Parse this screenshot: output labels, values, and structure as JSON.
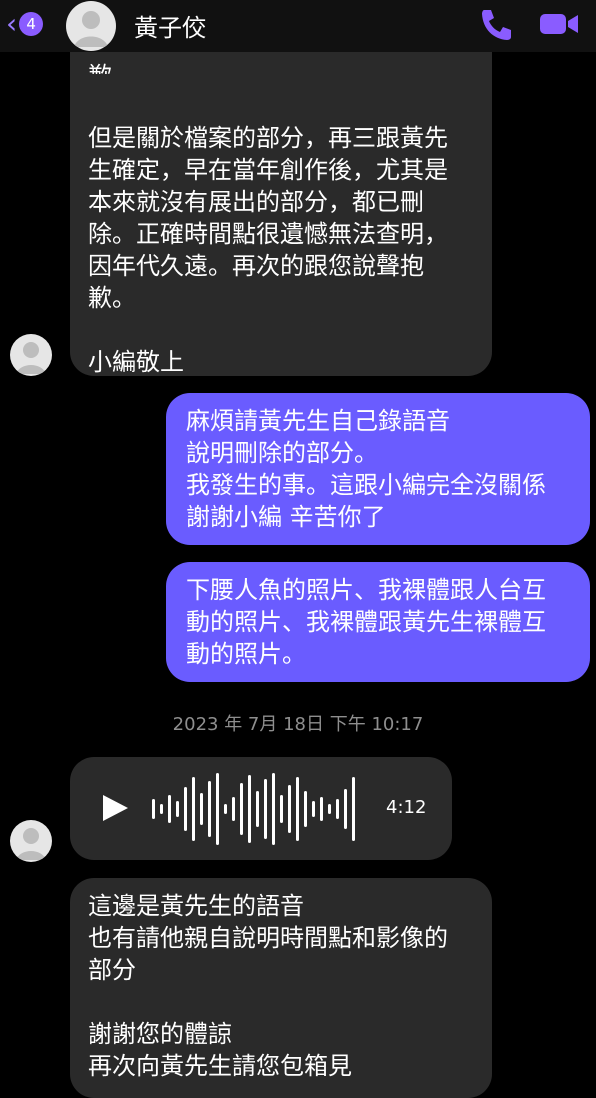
{
  "header": {
    "back_badge": "4",
    "contact_name": "黃子佼"
  },
  "messages": {
    "m1_top_fragment": "歉。",
    "m1_text": "但是關於檔案的部分，再三跟黃先\n生確定，早在當年創作後，尤其是\n本來就沒有展出的部分，都已刪\n除。正確時間點很遺憾無法查明，\n因年代久遠。再次的跟您說聲抱\n歉。\n\n小編敬上",
    "m2_text": "麻煩請黃先生自己錄語音\n說明刪除的部分。\n我發生的事。這跟小編完全沒關係\n謝謝小編 辛苦你了",
    "m3_text": "下腰人魚的照片、我裸體跟人台互\n動的照片、我裸體跟黃先生裸體互\n動的照片。",
    "timestamp": "2023 年 7月 18日 下午 10:17",
    "voice_duration": "4:12",
    "m4_text": "這邊是黃先生的語音\n也有請他親自說明時間點和影像的\n部分\n\n謝謝您的體諒\n再次向黃先生請您包箱見"
  },
  "colors": {
    "accent": "#8a5cff",
    "outgoing_bubble": "#6a5cff",
    "incoming_bubble": "#2a2a2a"
  },
  "icons": {
    "back": "chevron-left-icon",
    "call": "phone-icon",
    "video": "video-camera-icon",
    "play": "play-icon"
  }
}
